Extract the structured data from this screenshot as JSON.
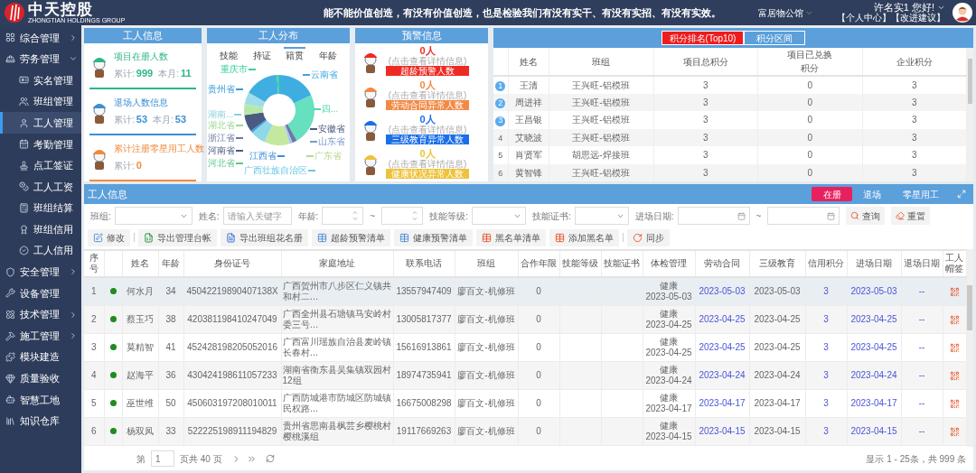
{
  "header": {
    "logo_text": "中天控股",
    "logo_subtitle": "ZHONGTIAN HOLDINGS GROUP",
    "slogan": "能不能价值创造，有没有价值创造，也是检验我们有没有实干、有没有实招、有没有实效。",
    "project": "富居物公馆",
    "greeting": "许名实1 您好!",
    "links": [
      "【个人中心】",
      "【改进建议】"
    ]
  },
  "sidebar": [
    {
      "label": "综合管理",
      "expanded": false,
      "selected": false
    },
    {
      "label": "劳务管理",
      "expanded": true,
      "selected": false,
      "children": [
        {
          "label": "实名管理",
          "selected": false
        },
        {
          "label": "班组管理",
          "selected": false
        },
        {
          "label": "工人管理",
          "selected": true
        },
        {
          "label": "考勤管理",
          "selected": false
        },
        {
          "label": "点工签证",
          "selected": false
        },
        {
          "label": "工人工资",
          "selected": false
        },
        {
          "label": "班组结算",
          "selected": false
        },
        {
          "label": "班组信用",
          "selected": false
        },
        {
          "label": "工人信用",
          "selected": false
        }
      ]
    },
    {
      "label": "安全管理",
      "expanded": false,
      "selected": false
    },
    {
      "label": "设备管理",
      "selected": false
    },
    {
      "label": "技术管理",
      "expanded": false,
      "selected": false
    },
    {
      "label": "施工管理",
      "expanded": false,
      "selected": false
    },
    {
      "label": "模块建造",
      "selected": false
    },
    {
      "label": "质量验收",
      "selected": false
    },
    {
      "label": "智慧工地",
      "selected": false
    },
    {
      "label": "知识仓库",
      "selected": false
    }
  ],
  "worker_info": {
    "title": "工人信息",
    "items": [
      {
        "title": "项目在册人数",
        "color": "#2fb58a",
        "stats": [
          {
            "label": "累计:",
            "value": "999"
          },
          {
            "label": "本月:",
            "value": "11"
          }
        ]
      },
      {
        "title": "退场人数信息",
        "color": "#3a8fd6",
        "stats": [
          {
            "label": "累计:",
            "value": "53"
          },
          {
            "label": "本月:",
            "value": "53"
          }
        ]
      },
      {
        "title": "累计注册零星用工人数",
        "color": "#f08a3c",
        "stats": [
          {
            "label": "累计:",
            "value": "0"
          }
        ]
      }
    ]
  },
  "distribution": {
    "title": "工人分布",
    "tabs": [
      {
        "label": "技能",
        "selected": false
      },
      {
        "label": "持证",
        "selected": false
      },
      {
        "label": "籍贯",
        "selected": true
      },
      {
        "label": "年龄",
        "selected": false
      }
    ],
    "labels": [
      {
        "text": "重庆市",
        "color": "#3ecf9a"
      },
      {
        "text": "云南省",
        "color": "#3ea6e0"
      },
      {
        "text": "贵州省",
        "color": "#3a9ad8"
      },
      {
        "text": "四...",
        "color": "#4fd8b0"
      },
      {
        "text": "湖南...",
        "color": "#8fcfe0"
      },
      {
        "text": "湖北省",
        "color": "#9ad890"
      },
      {
        "text": "浙江省",
        "color": "#6a7aa0"
      },
      {
        "text": "河南省",
        "color": "#4a5a80"
      },
      {
        "text": "河北省",
        "color": "#5cc88a"
      },
      {
        "text": "安徽省",
        "color": "#4a5a80"
      },
      {
        "text": "山东省",
        "color": "#7a9ad0"
      },
      {
        "text": "广东省",
        "color": "#b8d890"
      },
      {
        "text": "江西省",
        "color": "#3a8fd6"
      },
      {
        "text": "广西壮族自治区",
        "color": "#6ac8e0"
      }
    ]
  },
  "warnings": {
    "title": "预警信息",
    "items": [
      {
        "count": "0人",
        "hint": "(点击查看详情信息)",
        "label": "超龄预警人数",
        "color": "#ee2a24"
      },
      {
        "count": "0人",
        "hint": "(点击查看详情信息)",
        "label": "劳动合同异常人数",
        "color": "#f28a46"
      },
      {
        "count": "0人",
        "hint": "(点击查看详情信息)",
        "label": "三级教育异常人数",
        "color": "#1a6fe8"
      },
      {
        "count": "0人",
        "hint": "(点击查看详情信息)",
        "label": "健康状况异常人数",
        "color": "#eec23a"
      }
    ]
  },
  "ranking": {
    "tabs": [
      {
        "label": "积分排名(Top10)",
        "selected": true
      },
      {
        "label": "积分区间",
        "selected": false
      }
    ],
    "columns": [
      "姓名",
      "班组",
      "项目总积分",
      "项目已兑换积分",
      "企业积分"
    ],
    "rows": [
      {
        "rank": "1",
        "top": true,
        "name": "王清",
        "team": "王兴旺-铝模班",
        "total": "3",
        "redeemed": "0",
        "enterprise": "3"
      },
      {
        "rank": "2",
        "top": true,
        "name": "周进祥",
        "team": "王兴旺-铝模班",
        "total": "3",
        "redeemed": "0",
        "enterprise": "3"
      },
      {
        "rank": "3",
        "top": true,
        "name": "王昌银",
        "team": "王兴旺-铝模班",
        "total": "3",
        "redeemed": "0",
        "enterprise": "3"
      },
      {
        "rank": "4",
        "top": false,
        "name": "艾晓波",
        "team": "王兴旺-铝模班",
        "total": "3",
        "redeemed": "0",
        "enterprise": "3"
      },
      {
        "rank": "5",
        "top": false,
        "name": "肖贤军",
        "team": "胡思远-焊接班",
        "total": "3",
        "redeemed": "0",
        "enterprise": "3"
      },
      {
        "rank": "6",
        "top": false,
        "name": "黄智锋",
        "team": "王兴旺-铝模班",
        "total": "3",
        "redeemed": "0",
        "enterprise": "3"
      }
    ]
  },
  "roster": {
    "title": "工人信息",
    "tabs": [
      {
        "label": "在册",
        "selected": true
      },
      {
        "label": "退场",
        "selected": false
      },
      {
        "label": "零星用工",
        "selected": false
      }
    ],
    "filters": [
      {
        "kind": "select",
        "label": "班组:"
      },
      {
        "kind": "text",
        "label": "姓名:",
        "placeholder": "请输入关键字"
      },
      {
        "kind": "number_range",
        "label": "年龄:",
        "separator": "~"
      },
      {
        "kind": "select",
        "label": "技能等级:"
      },
      {
        "kind": "select",
        "label": "技能证书:"
      },
      {
        "kind": "date_range",
        "label": "进场日期:",
        "separator": "~"
      }
    ],
    "actions": [
      {
        "kind": "search",
        "label": "查询"
      },
      {
        "kind": "reset",
        "label": "重置"
      }
    ],
    "toolbar_groups": [
      [
        {
          "kind": "edit",
          "label": "修改"
        }
      ],
      [
        {
          "kind": "excel",
          "label": "导出管理台帐"
        },
        {
          "kind": "word",
          "label": "导出班组花名册"
        },
        {
          "kind": "list",
          "label": "超龄预警清单"
        },
        {
          "kind": "list",
          "label": "健康预警清单"
        },
        {
          "kind": "blacklist",
          "label": "黑名单清单"
        },
        {
          "kind": "blacklist",
          "label": "添加黑名单"
        }
      ],
      [
        {
          "kind": "sync",
          "label": "同步"
        }
      ]
    ],
    "columns": [
      {
        "label": "序号"
      },
      {
        "kind": "status"
      },
      {
        "label": "姓名"
      },
      {
        "label": "年龄"
      },
      {
        "label": "身份证号"
      },
      {
        "label": "家庭地址"
      },
      {
        "label": "联系电话"
      },
      {
        "label": "班组"
      },
      {
        "label": "合作年限"
      },
      {
        "label": "技能等级"
      },
      {
        "label": "技能证书"
      },
      {
        "label": "体检管理"
      },
      {
        "label": "劳动合同"
      },
      {
        "label": "三级教育"
      },
      {
        "label": "信用积分"
      },
      {
        "label": "进场日期"
      },
      {
        "label": "退场日期"
      },
      {
        "label": "工人帽签"
      }
    ],
    "rows": [
      {
        "selected": true,
        "no": "1",
        "color": "#1e8c1e",
        "name": "何水月",
        "age": "34",
        "id_number": "45042219890407138X",
        "address": "广西贺州市八步区仁义镇共和村二…",
        "phone": "13557947409",
        "team": "廖百文-机修班",
        "years": "0",
        "health": "健康",
        "health_date": "2023-05-03",
        "contract": "2023-05-03",
        "education": "2023-05-03",
        "credit": "3",
        "entry": "2023-05-03",
        "exit": "--"
      },
      {
        "selected": false,
        "no": "2",
        "color": "#1e8c1e",
        "name": "蔡玉巧",
        "age": "38",
        "id_number": "420381198410247049",
        "address": "广西全州县石塘镇马安岭村委三号…",
        "phone": "13005817377",
        "team": "廖百文-机修班",
        "years": "0",
        "health": "健康",
        "health_date": "2023-04-25",
        "contract": "2023-04-25",
        "education": "2023-04-25",
        "credit": "3",
        "entry": "2023-04-25",
        "exit": "--"
      },
      {
        "selected": false,
        "no": "3",
        "color": "#1e8c1e",
        "name": "莫精智",
        "age": "41",
        "id_number": "452428198205052016",
        "address": "广西富川瑶族自治县麦岭镇长春村…",
        "phone": "15616913861",
        "team": "廖百文-机修班",
        "years": "0",
        "health": "健康",
        "health_date": "2023-04-25",
        "contract": "2023-04-25",
        "education": "2023-04-25",
        "credit": "3",
        "entry": "2023-04-25",
        "exit": "--"
      },
      {
        "selected": false,
        "no": "4",
        "color": "#1e8c1e",
        "name": "赵海平",
        "age": "36",
        "id_number": "430424198611057233",
        "address": "湖南省衡东县吴集镇双园村12组",
        "phone": "18974735941",
        "team": "廖百文-机修班",
        "years": "0",
        "health": "健康",
        "health_date": "2023-04-24",
        "contract": "2023-04-24",
        "education": "2023-04-24",
        "credit": "3",
        "entry": "2023-04-24",
        "exit": "--"
      },
      {
        "selected": false,
        "no": "5",
        "color": "#1e8c1e",
        "name": "巫世维",
        "age": "50",
        "id_number": "450603197208010011",
        "address": "广西防城港市防城区防城镇民权路…",
        "phone": "16675008298",
        "team": "廖百文-机修班",
        "years": "0",
        "health": "健康",
        "health_date": "2023-04-17",
        "contract": "2023-04-17",
        "education": "2023-04-17",
        "credit": "3",
        "entry": "2023-04-17",
        "exit": "--"
      },
      {
        "selected": false,
        "no": "6",
        "color": "#1e8c1e",
        "name": "杨双凤",
        "age": "33",
        "id_number": "522225198911194829",
        "address": "贵州省思南县枫芸乡樱桃村樱桃溪组",
        "phone": "19117669263",
        "team": "廖百文-机修班",
        "years": "0",
        "health": "健康",
        "health_date": "2023-04-15",
        "contract": "2023-04-15",
        "education": "2023-04-15",
        "credit": "3",
        "entry": "2023-04-15",
        "exit": "--"
      }
    ]
  },
  "pagination": {
    "page_prefix": "第",
    "page": "1",
    "page_suffix": "页共 40 页",
    "summary": "显示 1 - 25条，共 999 条"
  }
}
